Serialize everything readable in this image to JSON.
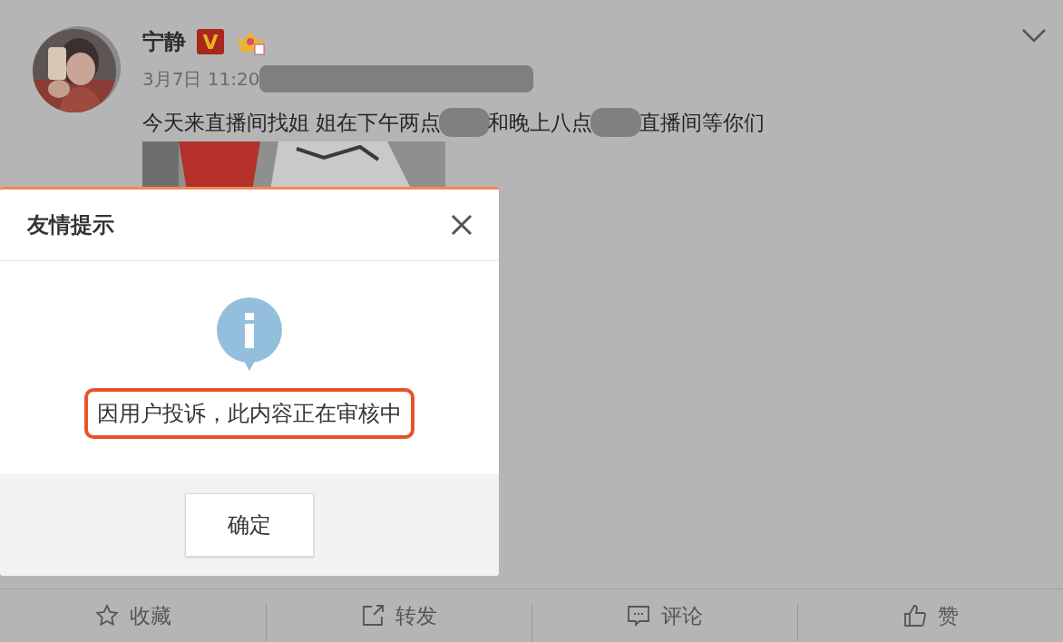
{
  "post": {
    "author": "宁静",
    "verified_badge": "V",
    "time": "3月7日 11:20",
    "time_redacted": true,
    "content": [
      {
        "kind": "text",
        "text": "今天来直播间找姐 姐在下午两点"
      },
      {
        "kind": "redacted"
      },
      {
        "kind": "text",
        "text": "和晚上八点"
      },
      {
        "kind": "redacted"
      },
      {
        "kind": "text",
        "text": "直播间等你们"
      }
    ]
  },
  "dialog": {
    "title": "友情提示",
    "message": "因用户投诉，此内容正在审核中",
    "message_highlighted": true,
    "confirm": "确定"
  },
  "actions": [
    {
      "kind": "star",
      "label": "收藏"
    },
    {
      "kind": "share",
      "label": "转发"
    },
    {
      "kind": "comment",
      "label": "评论"
    },
    {
      "kind": "like",
      "label": "赞"
    }
  ]
}
